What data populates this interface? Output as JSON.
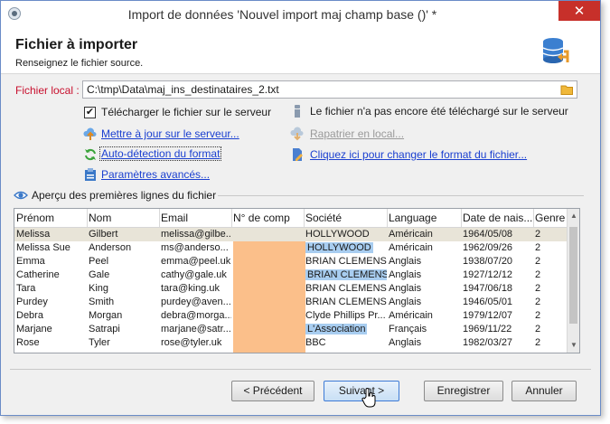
{
  "window": {
    "title": "Import de données 'Nouvel import maj champ base ()' *",
    "close_glyph": "✕"
  },
  "header": {
    "title": "Fichier à importer",
    "subtitle": "Renseignez le fichier source."
  },
  "file": {
    "label": "Fichier local :",
    "value": "C:\\tmp\\Data\\maj_ins_destinataires_2.txt"
  },
  "options": {
    "upload_checkbox_label": "Télécharger le fichier sur le serveur",
    "upload_checked": true,
    "info_text": "Le fichier n'a pas encore été téléchargé sur le serveur",
    "update_link": "Mettre à jour sur le serveur...",
    "retrieve_link": "Rapatrier en local...",
    "autodetect_link": "Auto-détection du format",
    "change_format_link": "Cliquez ici pour changer le format du fichier...",
    "advanced_link": "Paramètres avancés..."
  },
  "preview": {
    "label": "Aperçu des premières lignes du fichier",
    "columns": [
      "Prénom",
      "Nom",
      "Email",
      "N° de comp",
      "Société",
      "Language",
      "Date de nais...",
      "Genre"
    ],
    "rows": [
      [
        "Melissa",
        "Gilbert",
        "melissa@gilbe...",
        "",
        "HOLLYWOOD",
        "Américain",
        "1964/05/08",
        "2"
      ],
      [
        "Melissa Sue",
        "Anderson",
        "ms@anderso...",
        "",
        "HOLLYWOOD",
        "Américain",
        "1962/09/26",
        "2"
      ],
      [
        "Emma",
        "Peel",
        "emma@peel.uk",
        "",
        "BRIAN CLEMENS",
        "Anglais",
        "1938/07/20",
        "2"
      ],
      [
        "Catherine",
        "Gale",
        "cathy@gale.uk",
        "",
        "BRIAN CLEMENS",
        "Anglais",
        "1927/12/12",
        "2"
      ],
      [
        "Tara",
        "King",
        "tara@king.uk",
        "",
        "BRIAN CLEMENS",
        "Anglais",
        "1947/06/18",
        "2"
      ],
      [
        "Purdey",
        "Smith",
        "purdey@aven...",
        "",
        "BRIAN CLEMENS",
        "Anglais",
        "1946/05/01",
        "2"
      ],
      [
        "Debra",
        "Morgan",
        "debra@morga...",
        "",
        "Clyde Phillips Pr...",
        "Américain",
        "1979/12/07",
        "2"
      ],
      [
        "Marjane",
        "Satrapi",
        "marjane@satr...",
        "",
        "L'Association",
        "Français",
        "1969/11/22",
        "2"
      ],
      [
        "Rose",
        "Tyler",
        "rose@tyler.uk",
        "",
        "BBC",
        "Anglais",
        "1982/03/27",
        "2"
      ]
    ],
    "highlighted_company_rows": [
      1,
      3,
      7
    ]
  },
  "buttons": {
    "previous": "< Précédent",
    "next": "Suivant >",
    "save": "Enregistrer",
    "cancel": "Annuler"
  },
  "colors": {
    "mapped_column": "#fbbf8a",
    "highlight": "#a8cdf0",
    "required_label": "#c8102e",
    "link": "#1a3fd0"
  }
}
